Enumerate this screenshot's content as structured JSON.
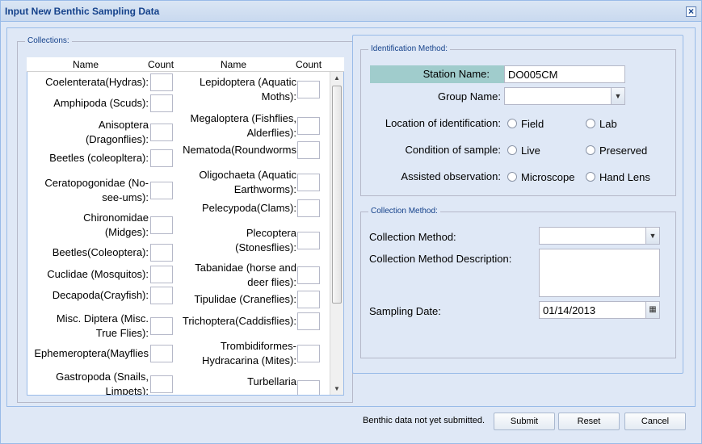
{
  "window": {
    "title": "Input New Benthic Sampling Data"
  },
  "collections": {
    "legend": "Collections:",
    "headers": {
      "name1": "Name",
      "count1": "Count",
      "name2": "Name",
      "count2": "Count"
    },
    "left": [
      [
        "Coelenterata(Hydras):"
      ],
      [
        "Amphipoda (Scuds):"
      ],
      [
        "Anisoptera",
        "(Dragonflies):"
      ],
      [
        "Beetles (coleopltera):"
      ],
      [
        "Ceratopogonidae (No-",
        "see-ums):"
      ],
      [
        "Chironomidae",
        "(Midges):"
      ],
      [
        "Beetles(Coleoptera):"
      ],
      [
        "Cuclidae (Mosquitos):"
      ],
      [
        "Decapoda(Crayfish):"
      ],
      [
        "Misc. Diptera (Misc.",
        "True Flies):"
      ],
      [
        "Ephemeroptera(Mayflies"
      ],
      [
        "Gastropoda (Snails,",
        "Limpets):"
      ]
    ],
    "right": [
      [
        "Lepidoptera (Aquatic",
        "Moths):"
      ],
      [
        "Megaloptera (Fishflies,",
        "Alderflies):"
      ],
      [
        "Nematoda(Roundworms"
      ],
      [
        "Oligochaeta (Aquatic",
        "Earthworms):"
      ],
      [
        "Pelecypoda(Clams):"
      ],
      [
        "Plecoptera",
        "(Stonesflies):"
      ],
      [
        "Tabanidae (horse and",
        "deer flies):"
      ],
      [
        "Tipulidae (Craneflies):"
      ],
      [
        "Trichoptera(Caddisflies):"
      ],
      [
        "Trombidiformes-",
        "Hydracarina (Mites):"
      ],
      [
        "Turbellaria",
        ""
      ]
    ]
  },
  "identification": {
    "legend": "Identification Method:",
    "station_label": "Station Name:",
    "station_value": "DO005CM",
    "group_label": "Group Name:",
    "group_value": "",
    "location_label": "Location of identification:",
    "location_opts": [
      "Field",
      "Lab"
    ],
    "condition_label": "Condition of sample:",
    "condition_opts": [
      "Live",
      "Preserved"
    ],
    "assisted_label": "Assisted observation:",
    "assisted_opts": [
      "Microscope",
      "Hand Lens"
    ]
  },
  "collection_method": {
    "legend": "Collection Method:",
    "method_label": "Collection Method:",
    "method_value": "",
    "desc_label": "Collection Method Description:",
    "date_label": "Sampling Date:",
    "date_value": "01/14/2013"
  },
  "footer": {
    "status": "Benthic data not yet submitted.",
    "submit": "Submit",
    "reset": "Reset",
    "cancel": "Cancel"
  }
}
